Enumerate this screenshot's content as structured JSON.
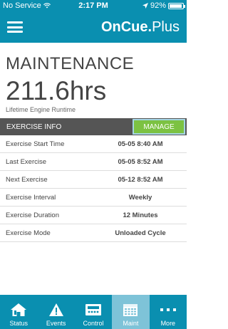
{
  "status_bar": {
    "carrier": "No Service",
    "time": "2:17 PM",
    "battery": "92%",
    "battery_level": 0.92
  },
  "header": {
    "logo_main": "OnCue.",
    "logo_plus": "Plus"
  },
  "main": {
    "title": "MAINTENANCE",
    "hours": "211.6hrs",
    "hours_caption": "Lifetime Engine Runtime"
  },
  "exercise": {
    "section_title": "EXERCISE INFO",
    "manage_label": "MANAGE",
    "rows": [
      {
        "label": "Exercise Start Time",
        "value": "05-05 8:40 AM"
      },
      {
        "label": "Last Exercise",
        "value": "05-05 8:52 AM"
      },
      {
        "label": "Next Exercise",
        "value": "05-12 8:52 AM"
      },
      {
        "label": "Exercise Interval",
        "value": "Weekly"
      },
      {
        "label": "Exercise Duration",
        "value": "12 Minutes"
      },
      {
        "label": "Exercise Mode",
        "value": "Unloaded Cycle"
      }
    ]
  },
  "tabs": [
    {
      "label": "Status",
      "icon": "home-icon"
    },
    {
      "label": "Events",
      "icon": "warning-icon"
    },
    {
      "label": "Control",
      "icon": "control-panel-icon"
    },
    {
      "label": "Maint",
      "icon": "calendar-icon",
      "active": true
    },
    {
      "label": "More",
      "icon": "more-dots-icon"
    }
  ],
  "colors": {
    "brand": "#0a8fb0",
    "manage_button": "#7cc242",
    "section_header": "#555555",
    "active_tab": "#7ec3d8"
  }
}
